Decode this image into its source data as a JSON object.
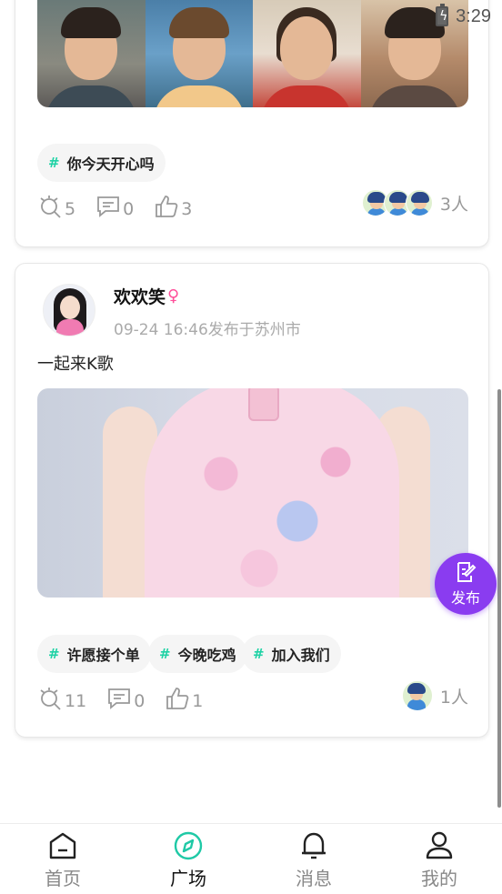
{
  "status_bar": {
    "time": "3:29"
  },
  "posts": [
    {
      "tags": [
        {
          "hash": "#",
          "label": "你今天开心吗"
        }
      ],
      "stats": {
        "views": "5",
        "comments": "0",
        "likes": "3"
      },
      "joined": "3人"
    },
    {
      "username": "欢欢笑",
      "gender_symbol": "♀",
      "meta": "09-24 16:46发布于苏州市",
      "text": "一起来K歌",
      "tags": [
        {
          "hash": "#",
          "label": "许愿接个单"
        },
        {
          "hash": "#",
          "label": "今晚吃鸡"
        },
        {
          "hash": "#",
          "label": "加入我们"
        }
      ],
      "stats": {
        "views": "11",
        "comments": "0",
        "likes": "1"
      },
      "joined": "1人"
    }
  ],
  "fab": {
    "label": "发布"
  },
  "tabs": [
    {
      "label": "首页",
      "icon": "home-icon"
    },
    {
      "label": "广场",
      "icon": "compass-icon"
    },
    {
      "label": "消息",
      "icon": "bell-icon"
    },
    {
      "label": "我的",
      "icon": "user-icon"
    }
  ],
  "colors": {
    "accent_purple": "#8a3cf0",
    "tag_hash": "#1fd2a5",
    "compass_teal": "#1fc9a6",
    "gender_pink": "#ff4f9a"
  }
}
